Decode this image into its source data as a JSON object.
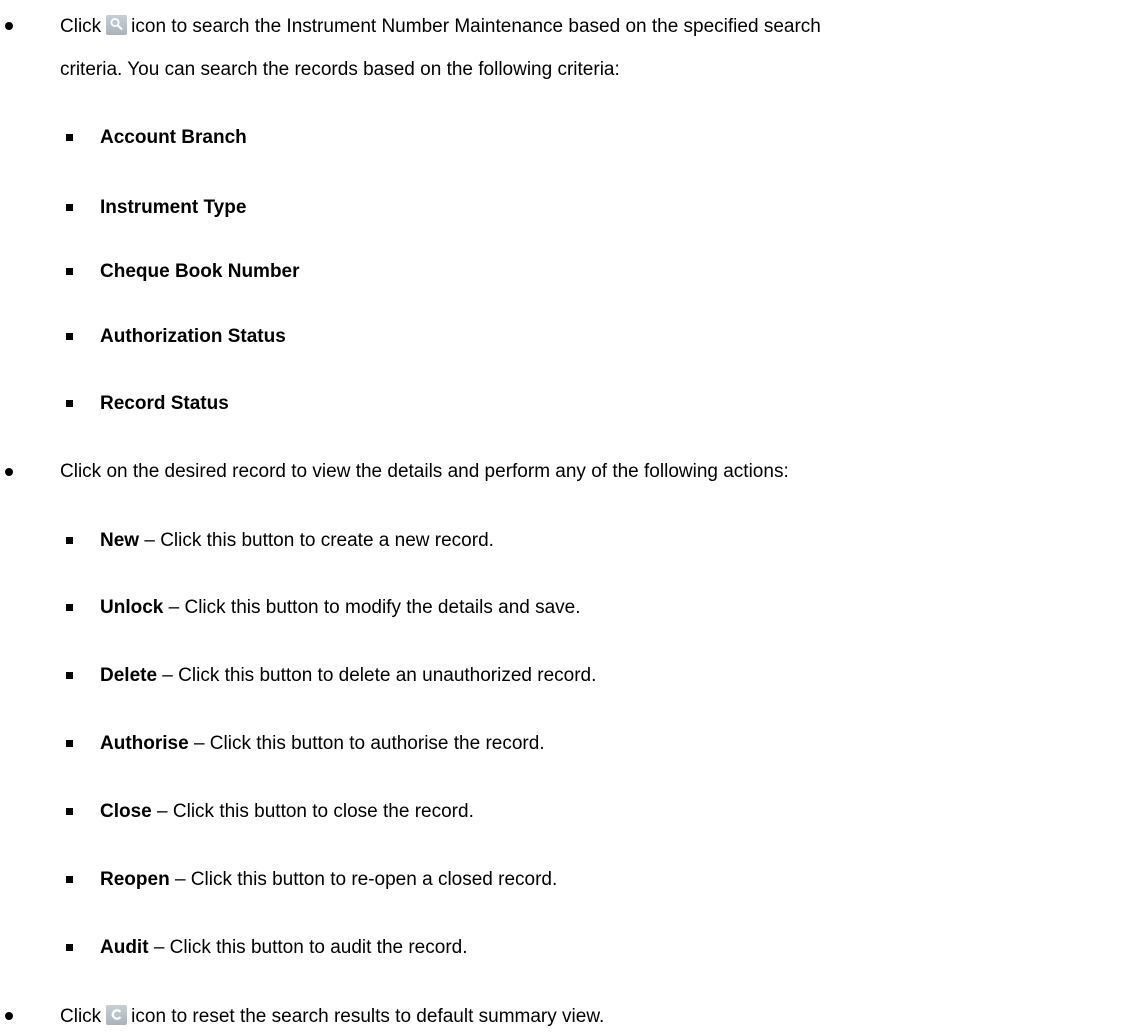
{
  "bullets": {
    "search": {
      "click": "Click",
      "icon": "search-icon",
      "text1": "icon to search the Instrument Number Maintenance based on the specified search",
      "text2": "criteria. You can search the records based on the following criteria:"
    },
    "criteria": [
      "Account Branch",
      "Instrument Type",
      "Cheque Book Number",
      "Authorization Status",
      "Record Status"
    ],
    "record": {
      "text": "Click on the desired record to view the details and perform any of the following actions:"
    },
    "actions": [
      {
        "name": "New",
        "desc": " – Click this button to create a new record."
      },
      {
        "name": "Unlock",
        "desc": " – Click this button to modify the details and save."
      },
      {
        "name": "Delete",
        "desc": " – Click this button to delete an unauthorized record."
      },
      {
        "name": "Authorise",
        "desc": " – Click this button to authorise the record."
      },
      {
        "name": "Close",
        "desc": " – Click this button to close the record."
      },
      {
        "name": "Reopen",
        "desc": " – Click this button to re-open a closed record."
      },
      {
        "name": "Audit",
        "desc": " – Click this button to audit the record."
      }
    ],
    "reset": {
      "click": "Click",
      "icon": "reset-icon",
      "text": "icon to reset the search results to default summary view."
    }
  }
}
